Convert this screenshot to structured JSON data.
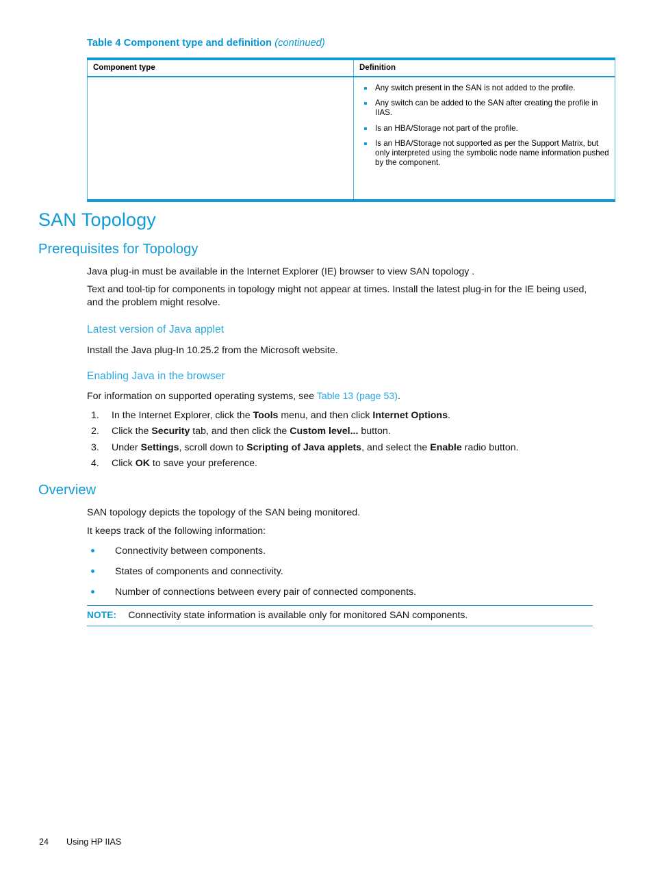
{
  "table": {
    "caption_main": "Table 4  Component type and definition",
    "caption_continued": "(continued)",
    "headers": {
      "col1": "Component type",
      "col2": "Definition"
    },
    "definition_bullets": [
      "Any switch present in the SAN is not added to the profile.",
      "Any switch can be added to the SAN after creating the profile in IIAS.",
      "Is an HBA/Storage not part of the profile.",
      "Is an HBA/Storage not supported as per the Support Matrix, but only interpreted using the symbolic node name information pushed by the component."
    ]
  },
  "sections": {
    "san_topology": {
      "title": "SAN Topology"
    },
    "prerequisites": {
      "title": "Prerequisites for Topology",
      "para1": "Java plug-in must be available in the Internet Explorer (IE) browser to view SAN topology .",
      "para2": "Text and tool-tip for components in topology might not appear at times. Install the latest plug-in for the IE being used, and the problem might resolve."
    },
    "java_applet": {
      "title": "Latest version of Java applet",
      "para": "Install the Java plug-In 10.25.2 from the Microsoft website."
    },
    "enabling_java": {
      "title": "Enabling Java in the browser",
      "intro_before_link": "For information on supported operating systems, see ",
      "intro_link": "Table 13 (page 53)",
      "intro_after_link": ".",
      "steps": [
        {
          "number": "1.",
          "parts": [
            {
              "text": "In the Internet Explorer, click the ",
              "bold": false
            },
            {
              "text": "Tools",
              "bold": true
            },
            {
              "text": " menu, and then click ",
              "bold": false
            },
            {
              "text": "Internet Options",
              "bold": true
            },
            {
              "text": ".",
              "bold": false
            }
          ]
        },
        {
          "number": "2.",
          "parts": [
            {
              "text": "Click the ",
              "bold": false
            },
            {
              "text": "Security",
              "bold": true
            },
            {
              "text": " tab, and then click the ",
              "bold": false
            },
            {
              "text": "Custom level...",
              "bold": true
            },
            {
              "text": " button.",
              "bold": false
            }
          ]
        },
        {
          "number": "3.",
          "parts": [
            {
              "text": "Under ",
              "bold": false
            },
            {
              "text": "Settings",
              "bold": true
            },
            {
              "text": ", scroll down to ",
              "bold": false
            },
            {
              "text": "Scripting of Java applets",
              "bold": true
            },
            {
              "text": ", and select the ",
              "bold": false
            },
            {
              "text": "Enable",
              "bold": true
            },
            {
              "text": " radio button.",
              "bold": false
            }
          ]
        },
        {
          "number": "4.",
          "parts": [
            {
              "text": "Click ",
              "bold": false
            },
            {
              "text": "OK",
              "bold": true
            },
            {
              "text": " to save your preference.",
              "bold": false
            }
          ]
        }
      ]
    },
    "overview": {
      "title": "Overview",
      "para1": "SAN topology depicts the topology of the SAN being monitored.",
      "para2": "It keeps track of the following information:",
      "bullets": [
        "Connectivity between components.",
        "States of components and connectivity.",
        "Number of connections between every pair of connected components."
      ]
    }
  },
  "note": {
    "label": "NOTE:",
    "text": "Connectivity state information is available only for monitored SAN components."
  },
  "footer": {
    "page_number": "24",
    "doc_title": "Using HP IIAS"
  },
  "colors": {
    "accent_blue": "#0e9ad6",
    "heading_blue": "#2aa8e0",
    "text_black": "#141414"
  }
}
